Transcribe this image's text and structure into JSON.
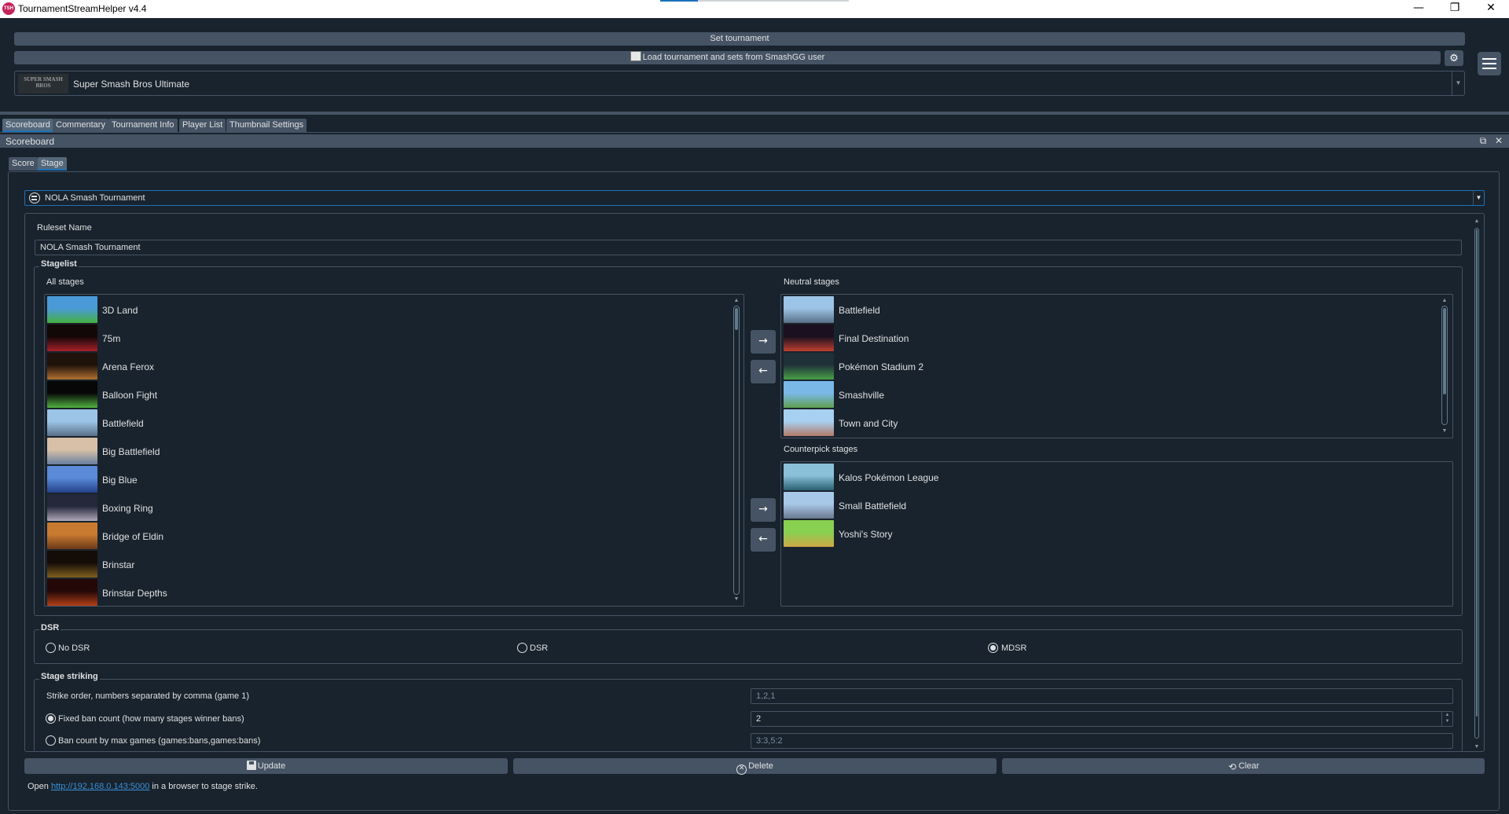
{
  "window": {
    "app_icon_text": "TSH",
    "title": "TournamentStreamHelper v4.4",
    "minimize_glyph": "—",
    "restore_glyph": "❐",
    "close_glyph": "✕"
  },
  "top": {
    "set_tournament_label": "Set tournament",
    "load_label": "Load tournament and sets from SmashGG user",
    "settings_glyph": "⚙",
    "game": {
      "logo_text": "SUPER SMASH BROS",
      "name": "Super Smash Bros Ultimate"
    }
  },
  "main_tabs": [
    "Scoreboard",
    "Commentary",
    "Tournament Info",
    "Player List",
    "Thumbnail Settings"
  ],
  "dock": {
    "title": "Scoreboard",
    "float_glyph": "⧉",
    "close_glyph": "✕"
  },
  "sub_tabs": [
    "Score",
    "Stage"
  ],
  "ruleset": {
    "selected": "NOLA Smash Tournament",
    "name_label": "Ruleset Name",
    "name_value": "NOLA Smash Tournament"
  },
  "stagelist": {
    "title": "Stagelist",
    "all_label": "All stages",
    "all_stages": [
      {
        "name": "3D Land",
        "c1": "#4a9ad8",
        "c2": "#46b040"
      },
      {
        "name": "75m",
        "c1": "#120808",
        "c2": "#a8202a"
      },
      {
        "name": "Arena Ferox",
        "c1": "#1e120a",
        "c2": "#b07030"
      },
      {
        "name": "Balloon Fight",
        "c1": "#070707",
        "c2": "#50b040"
      },
      {
        "name": "Battlefield",
        "c1": "#9cc4e6",
        "c2": "#5a7088"
      },
      {
        "name": "Big Battlefield",
        "c1": "#d8c0a8",
        "c2": "#6880a0"
      },
      {
        "name": "Big Blue",
        "c1": "#5a8ad8",
        "c2": "#24408a"
      },
      {
        "name": "Boxing Ring",
        "c1": "#24283a",
        "c2": "#b0a8b8"
      },
      {
        "name": "Bridge of Eldin",
        "c1": "#c87a30",
        "c2": "#6a3818"
      },
      {
        "name": "Brinstar",
        "c1": "#140c06",
        "c2": "#806020"
      },
      {
        "name": "Brinstar Depths",
        "c1": "#240808",
        "c2": "#b04018"
      }
    ],
    "neutral_label": "Neutral stages",
    "neutral_stages": [
      {
        "name": "Battlefield",
        "c1": "#9cc4e6",
        "c2": "#5a7088"
      },
      {
        "name": "Final Destination",
        "c1": "#1a1020",
        "c2": "#c04030"
      },
      {
        "name": "Pokémon Stadium 2",
        "c1": "#203038",
        "c2": "#48a048"
      },
      {
        "name": "Smashville",
        "c1": "#7ab8e8",
        "c2": "#60a050"
      },
      {
        "name": "Town and City",
        "c1": "#a8d0f0",
        "c2": "#b07a68"
      }
    ],
    "counterpick_label": "Counterpick stages",
    "counterpick_stages": [
      {
        "name": "Kalos Pokémon League",
        "c1": "#8ac0d8",
        "c2": "#2a6070"
      },
      {
        "name": "Small Battlefield",
        "c1": "#a8c8e8",
        "c2": "#6a7890"
      },
      {
        "name": "Yoshi's Story",
        "c1": "#88d050",
        "c2": "#d0a848"
      }
    ],
    "add_glyph": "→",
    "remove_glyph": "←"
  },
  "dsr": {
    "title": "DSR",
    "options": [
      "No DSR",
      "DSR",
      "MDSR"
    ],
    "selected": "MDSR"
  },
  "striking": {
    "title": "Stage striking",
    "strike_order_label": "Strike order, numbers separated by comma (game 1)",
    "strike_order_placeholder": "1,2,1",
    "fixed_ban_label": "Fixed ban count (how many stages winner bans)",
    "fixed_ban_value": "2",
    "max_games_label": "Ban count by max games (games:bans,games:bans)",
    "max_games_placeholder": "3:3,5:2",
    "selected": "fixed"
  },
  "actions": {
    "update_label": "Update",
    "delete_label": "Delete",
    "clear_label": "Clear",
    "clear_glyph": "⟲"
  },
  "hint": {
    "prefix": "Open ",
    "url": "http://192.168.0.143:5000",
    "suffix": " in a browser to stage strike."
  },
  "colors": {
    "background": "#19232d",
    "button": "#455364",
    "accent": "#1a72bb",
    "text": "#dfe1e2"
  }
}
